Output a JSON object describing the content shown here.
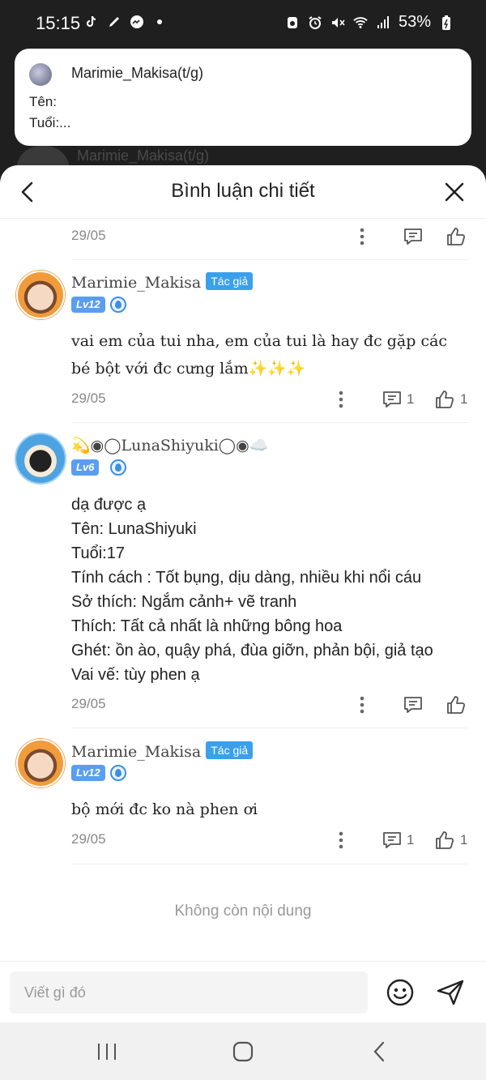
{
  "status_bar": {
    "time": "15:15",
    "battery": "53%",
    "left_icons": [
      "tiktok-icon",
      "pen-icon",
      "messenger-icon",
      "dot-icon"
    ],
    "right_icons": [
      "recycle-icon",
      "alarm-icon",
      "mute-icon",
      "wifi-icon",
      "signal-icon",
      "battery-icon"
    ]
  },
  "notification": {
    "title": "Marimie_Makisa(t/g)",
    "line1": "Tên:",
    "line2": "Tuổi:..."
  },
  "behind": {
    "name": "Marimie_Makisa(t/g)"
  },
  "header": {
    "title": "Bình luận chi tiết"
  },
  "comments": [
    {
      "date": "29/05"
    },
    {
      "user": "Marimie_Makisa",
      "badge": "Tác giả",
      "level": "Lv12",
      "text": "vai em của tui nha, em của tui là hay đc gặp các bé bột với đc cưng lắm✨✨✨",
      "date": "29/05",
      "reply_count": "1",
      "like_count": "1"
    },
    {
      "user": "💫◉◯LunaShiyuki◯◉☁️",
      "level": "Lv6",
      "lines": [
        "dạ được ạ",
        "Tên: LunaShiyuki",
        "Tuổi:17",
        "Tính cách : Tốt bụng, dịu dàng, nhiều khi nổi cáu",
        "Sở thích: Ngắm cảnh+ vẽ tranh",
        "Thích: Tất cả nhất là những bông hoa",
        "Ghét: ồn ào, quậy phá,  đùa giỡn, phản bội, giả tạo",
        "Vai vế: tùy phen ạ"
      ],
      "date": "29/05"
    },
    {
      "user": "Marimie_Makisa",
      "badge": "Tác giả",
      "level": "Lv12",
      "text": "bộ mới đc ko nà phen ơi",
      "date": "29/05",
      "reply_count": "1",
      "like_count": "1"
    }
  ],
  "footer": {
    "no_more": "Không còn nội dung"
  },
  "input": {
    "placeholder": "Viết gì đó"
  },
  "colors": {
    "accent": "#3aa0ec",
    "level_badge": "#5a9ef0"
  }
}
